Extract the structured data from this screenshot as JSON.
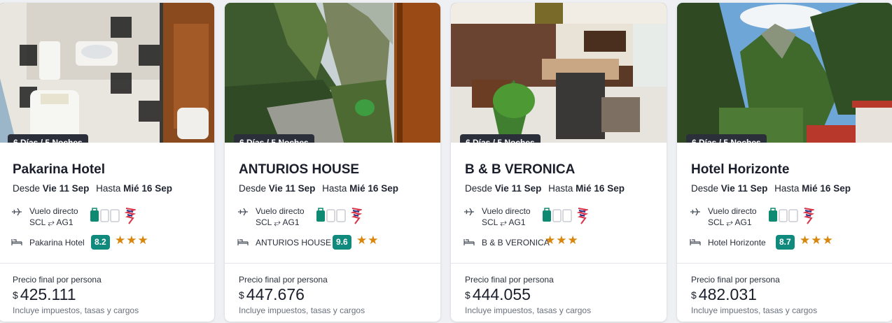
{
  "cards": [
    {
      "duration": "6 Días / 5 Noches",
      "name": "Pakarina Hotel",
      "desde_label": "Desde",
      "desde_date": "Vie 11 Sep",
      "hasta_label": "Hasta",
      "hasta_date": "Mié 16 Sep",
      "flight_type": "Vuelo directo",
      "route": "SCL ⥂ AG1",
      "hotel": "Pakarina Hotel",
      "score": "8.2",
      "stars": "★★★",
      "price_label": "Precio final por persona",
      "currency": "$",
      "price": "425.111",
      "taxes": "Incluye impuestos, tasas y cargos"
    },
    {
      "duration": "6 Días / 5 Noches",
      "name": "ANTURIOS HOUSE",
      "desde_label": "Desde",
      "desde_date": "Vie 11 Sep",
      "hasta_label": "Hasta",
      "hasta_date": "Mié 16 Sep",
      "flight_type": "Vuelo directo",
      "route": "SCL ⥂ AG1",
      "hotel": "ANTURIOS HOUSE",
      "score": "9.6",
      "stars": "★★",
      "price_label": "Precio final por persona",
      "currency": "$",
      "price": "447.676",
      "taxes": "Incluye impuestos, tasas y cargos"
    },
    {
      "duration": "6 Días / 5 Noches",
      "name": "B & B VERONICA",
      "desde_label": "Desde",
      "desde_date": "Vie 11 Sep",
      "hasta_label": "Hasta",
      "hasta_date": "Mié 16 Sep",
      "flight_type": "Vuelo directo",
      "route": "SCL ⥂ AG1",
      "hotel": "B & B VERONICA",
      "score": "",
      "stars": "★★★",
      "price_label": "Precio final por persona",
      "currency": "$",
      "price": "444.055",
      "taxes": "Incluye impuestos, tasas y cargos"
    },
    {
      "duration": "6 Días / 5 Noches",
      "name": "Hotel Horizonte",
      "desde_label": "Desde",
      "desde_date": "Vie 11 Sep",
      "hasta_label": "Hasta",
      "hasta_date": "Mié 16 Sep",
      "flight_type": "Vuelo directo",
      "route": "SCL ⥂ AG1",
      "hotel": "Hotel Horizonte",
      "score": "8.7",
      "stars": "★★★",
      "price_label": "Precio final por persona",
      "currency": "$",
      "price": "482.031",
      "taxes": "Incluye impuestos, tasas y cargos"
    }
  ],
  "colors": {
    "score_badge": "#108a7c",
    "stars": "#d9860d",
    "luggage_included": "#0f8a72",
    "luggage_excluded": "#c9ccd2"
  },
  "icons": {
    "flight": "plane-icon",
    "hotel": "bed-icon",
    "luggage": "luggage-icons",
    "airline": "airline-logo-icon"
  }
}
